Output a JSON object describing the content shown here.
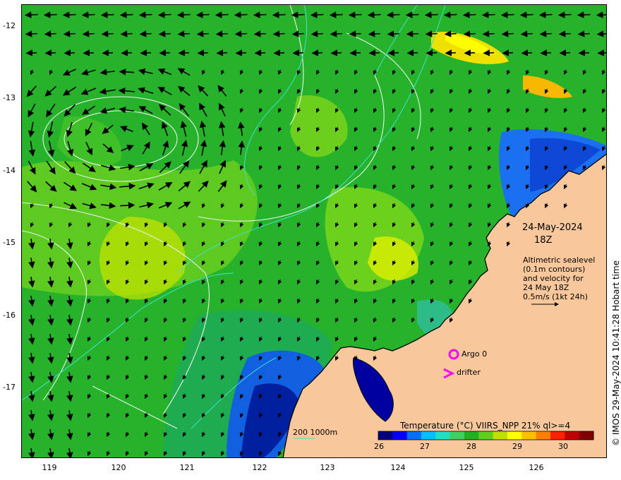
{
  "map": {
    "y_ticks": [
      "-12",
      "-13",
      "-14",
      "-15",
      "-16",
      "-17"
    ],
    "x_ticks": [
      "119",
      "120",
      "121",
      "122",
      "123",
      "124",
      "125",
      "126"
    ],
    "lon_range": [
      118.6,
      126.9
    ],
    "lat_range": [
      -11.94,
      -17.95
    ]
  },
  "annotation": {
    "date": "24-May-2024",
    "time": "18Z",
    "info_lines": [
      "Altimetric sealevel",
      "(0.1m contours)",
      "and velocity for",
      "24 May 18Z",
      "0.5m/s (1kt 24h)"
    ]
  },
  "legend": {
    "argo_label": "Argo 0",
    "drifter_label": "drifter",
    "argo_color": "#ff00ff",
    "drifter_color": "#ff00ff",
    "isobath_label": "200  1000m",
    "isobath_color": "#40e0d0"
  },
  "colorbar": {
    "title": "Temperature (°C) VIIRS_NPP 21% ql>=4",
    "ticks": [
      "26",
      "27",
      "28",
      "29",
      "30"
    ],
    "range": [
      26,
      30.7
    ],
    "colors": [
      "#000080",
      "#0000ff",
      "#0070ff",
      "#00c0ff",
      "#20e0c0",
      "#40d060",
      "#20b020",
      "#60d020",
      "#c0e000",
      "#ffff00",
      "#ffc000",
      "#ff8000",
      "#ff2000",
      "#c00000",
      "#800000"
    ]
  },
  "credit": "© IMOS 29-May-2024 10:41:28 Hobart time",
  "colors": {
    "land": "#f8c89c",
    "coast": "#000000",
    "sea_main": "#28b428",
    "sea_warm": "#d8e800",
    "sea_cool": "#2080ff",
    "contour": "#e8f0e8"
  }
}
